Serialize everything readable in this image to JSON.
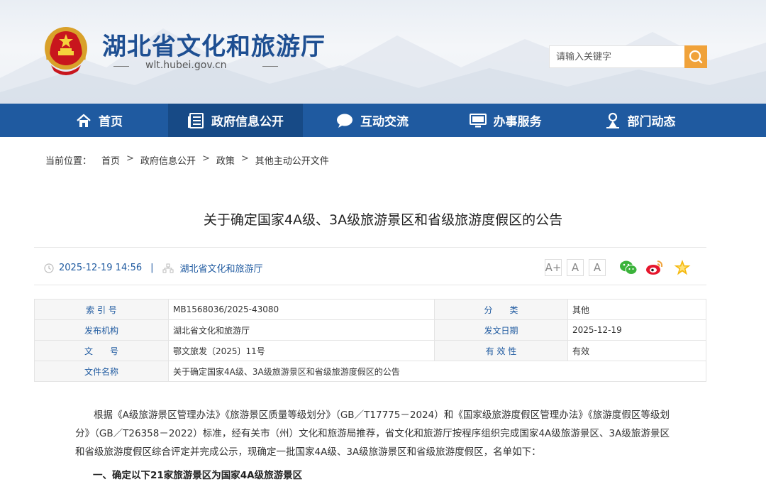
{
  "site": {
    "title": "湖北省文化和旅游厅",
    "domain": "wlt.hubei.gov.cn",
    "search_placeholder": "请输入关键字",
    "brand_color": "#1f5aa0",
    "search_button_color": "#f0a23a"
  },
  "nav": {
    "items": [
      {
        "label": "首页",
        "icon": "home-icon"
      },
      {
        "label": "政府信息公开",
        "icon": "document-list-icon"
      },
      {
        "label": "互动交流",
        "icon": "chat-bubble-icon"
      },
      {
        "label": "办事服务",
        "icon": "monitor-icon"
      },
      {
        "label": "部门动态",
        "icon": "person-pin-icon"
      }
    ],
    "active_index": 1
  },
  "breadcrumb": {
    "label": "当前位置：",
    "items": [
      "首页",
      "政府信息公开",
      "政策",
      "其他主动公开文件"
    ],
    "separator": ">"
  },
  "article": {
    "title": "关于确定国家4A级、3A级旅游景区和省级旅游度假区的公告",
    "datetime": "2025-12-19 14:56",
    "source": "湖北省文化和旅游厅",
    "font_buttons": [
      "A+",
      "A",
      "A"
    ]
  },
  "meta_table": {
    "rows": [
      {
        "k1": "索 引 号",
        "v1": "MB1568036/2025-43080",
        "k2": "分　　类",
        "v2": "其他"
      },
      {
        "k1": "发布机构",
        "v1": "湖北省文化和旅游厅",
        "k2": "发文日期",
        "v2": "2025-12-19"
      },
      {
        "k1": "文　　号",
        "v1": "鄂文旅发〔2025〕11号",
        "k2": "有 效 性",
        "v2": "有效"
      },
      {
        "k1": "文件名称",
        "v1": "关于确定国家4A级、3A级旅游景区和省级旅游度假区的公告"
      }
    ]
  },
  "body": {
    "paragraph": "根据《A级旅游景区管理办法》《旅游景区质量等级划分》（GB／T17775－2024）和《国家级旅游度假区管理办法》《旅游度假区等级划分》（GB／T26358－2022）标准，经有关市（州）文化和旅游局推荐，省文化和旅游厅按程序组织完成国家4A级旅游景区、3A级旅游景区和省级旅游度假区综合评定并完成公示，现确定一批国家4A级、3A级旅游景区和省级旅游度假区，名单如下：",
    "section_heading": "一、确定以下21家旅游景区为国家4A级旅游景区"
  }
}
